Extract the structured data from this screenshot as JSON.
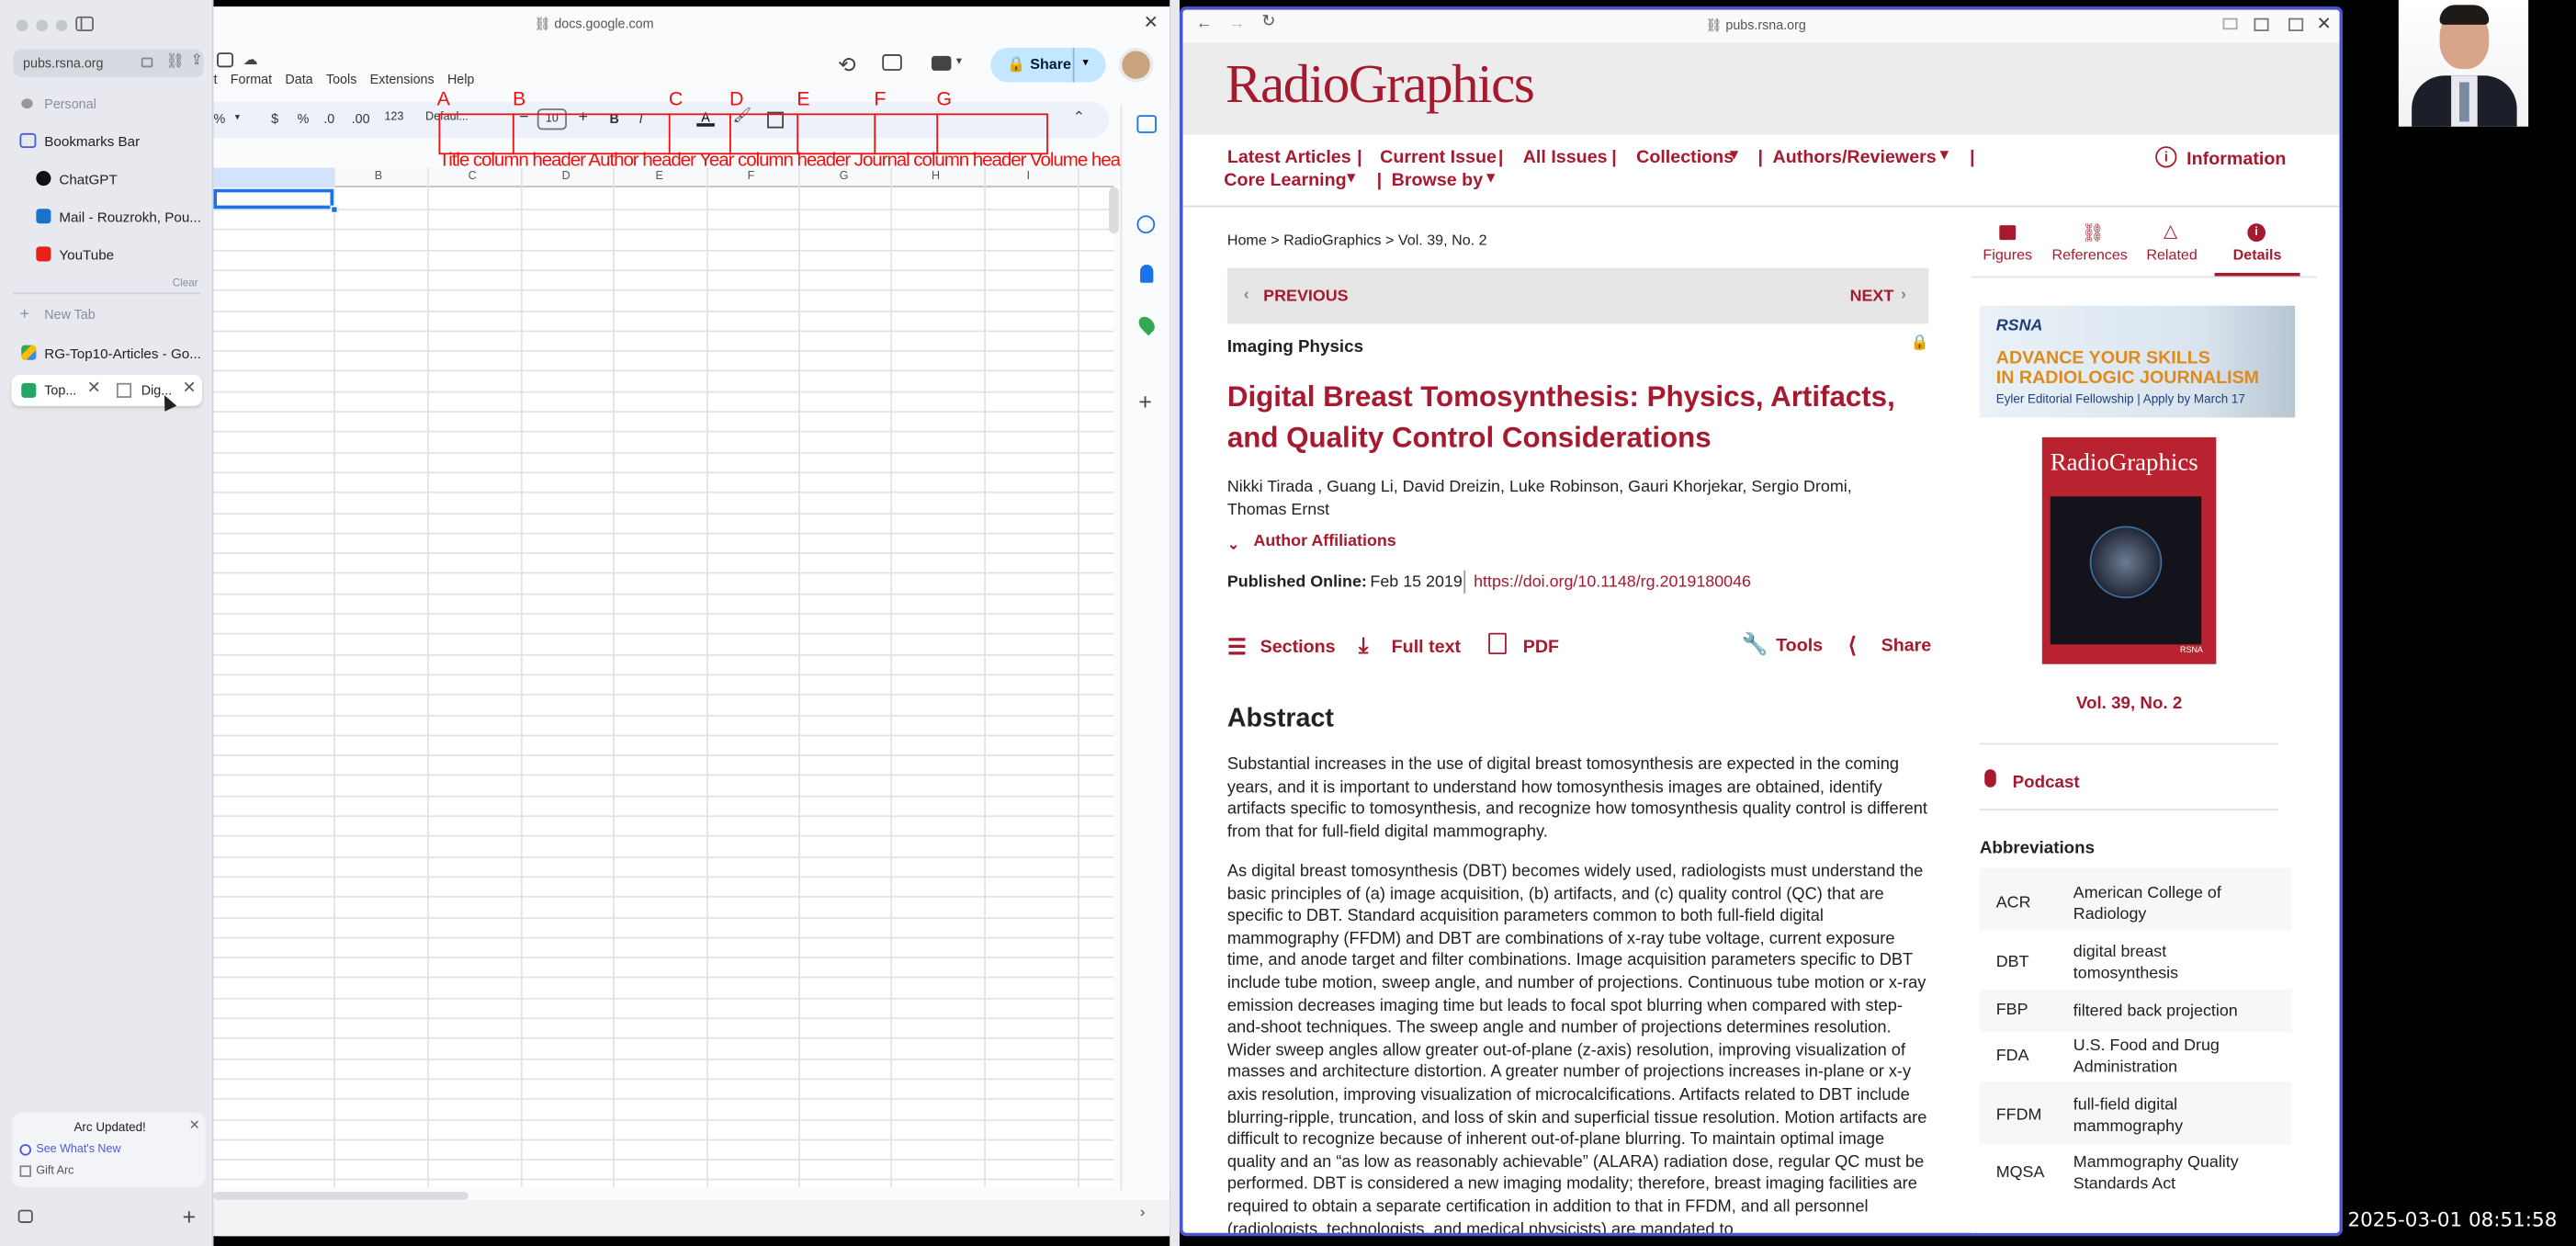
{
  "sidebar": {
    "url": "pubs.rsna.org",
    "personal": "Personal",
    "bookmarks_bar": "Bookmarks Bar",
    "bookmarks": [
      "ChatGPT",
      "Mail - Rouzrokh, Pou...",
      "YouTube"
    ],
    "clear": "Clear",
    "new_tab": "New Tab",
    "tabs": [
      "RG-Top10-Articles - Go..."
    ],
    "split_tabs": [
      "Top...",
      "Dig..."
    ],
    "update_title": "Arc Updated!",
    "update_link1": "See What's New",
    "update_link2": "Gift Arc"
  },
  "sheets": {
    "url": "docs.google.com",
    "menu": [
      "t",
      "Format",
      "Data",
      "Tools",
      "Extensions",
      "Help"
    ],
    "share": "Share",
    "toolbar": {
      "pct": "%",
      "dollar": "$",
      "percent": "%",
      "dec1": ".0",
      "dec2": ".00",
      "num": "123",
      "font": "Defaul...",
      "size": "10",
      "bold": "B",
      "italic": "I"
    },
    "letters": [
      "A",
      "B",
      "C",
      "D",
      "E",
      "F",
      "G"
    ],
    "overlap_text": "Title column header Author header Year column header Journal column header Volume header Issue header Pages header DOI column header",
    "col_headers": [
      "B",
      "C",
      "D",
      "E",
      "F",
      "G",
      "H",
      "I"
    ]
  },
  "rg": {
    "url": "pubs.rsna.org",
    "logo": "RadioGraphics",
    "nav": [
      "Latest Articles",
      "Current Issue",
      "All Issues",
      "Collections",
      "Authors/Reviewers",
      "Core Learning",
      "Browse by"
    ],
    "sep": "|",
    "info": "Information",
    "breadcrumb": "Home > RadioGraphics > Vol. 39, No. 2",
    "prev": "PREVIOUS",
    "next": "NEXT",
    "section": "Imaging Physics",
    "title": "Digital Breast Tomosynthesis: Physics, Artifacts, and Quality Control Considerations",
    "authors_l1": "Nikki Tirada , Guang Li, David Dreizin, Luke Robinson, Gauri Khorjekar, Sergio Dromi,",
    "authors_l2": "Thomas Ernst",
    "affiliations": "Author Affiliations",
    "pub_label": "Published Online:",
    "pub_date": "Feb 15 2019",
    "doi": "https://doi.org/10.1148/rg.2019180046",
    "actions": [
      "Sections",
      "Full text",
      "PDF",
      "Tools",
      "Share"
    ],
    "abstract_h": "Abstract",
    "p1": "Substantial increases in the use of digital breast tomosynthesis are expected in the coming years, and it is important to understand how tomosynthesis images are obtained, identify artifacts specific to tomosynthesis, and recognize how tomosynthesis quality control is different from that for full-field digital mammography.",
    "p2": "As digital breast tomosynthesis (DBT) becomes widely used, radiologists must understand the basic principles of (a) image acquisition, (b) artifacts, and (c) quality control (QC) that are specific to DBT. Standard acquisition parameters common to both full-field digital mammography (FFDM) and DBT are combinations of x-ray tube voltage, current exposure time, and anode target and filter combinations. Image acquisition parameters specific to DBT include tube motion, sweep angle, and number of projections. Continuous tube motion or x-ray emission decreases imaging time but leads to focal spot blurring when compared with step-and-shoot techniques. The sweep angle and number of projections determines resolution. Wider sweep angles allow greater out-of-plane (z-axis) resolution, improving visualization of masses and architecture distortion. A greater number of projections increases in-plane or x-y axis resolution, improving visualization of microcalcifications. Artifacts related to DBT include blurring-ripple, truncation, and loss of skin and superficial tissue resolution. Motion artifacts are difficult to recognize because of inherent out-of-plane blurring. To maintain optimal image quality and an “as low as reasonably achievable” (ALARA) radiation dose, regular QC must be performed. DBT is considered a new imaging modality; therefore, breast imaging facilities are required to obtain a separate certification in addition to that in FFDM, and all personnel (radiologists, technologists, and medical physicists) are mandated to",
    "right_tabs": [
      "Figures",
      "References",
      "Related",
      "Details"
    ],
    "ad": {
      "brand": "RSNA",
      "l1": "ADVANCE YOUR SKILLS",
      "l2": "IN RADIOLOGIC JOURNALISM",
      "l3": "Eyler Editorial Fellowship | Apply by March 17"
    },
    "cover_title": "RadioGraphics",
    "cover_brand": "RSNA",
    "vol": "Vol. 39, No. 2",
    "podcast": "Podcast",
    "abbr_h": "Abbreviations",
    "abbr": [
      {
        "k": "ACR",
        "v": "American College of Radiology"
      },
      {
        "k": "DBT",
        "v": "digital breast tomosynthesis"
      },
      {
        "k": "FBP",
        "v": "filtered back projection"
      },
      {
        "k": "FDA",
        "v": "U.S. Food and Drug Administration"
      },
      {
        "k": "FFDM",
        "v": "full-field digital mammography"
      },
      {
        "k": "MQSA",
        "v": "Mammography Quality Standards Act"
      }
    ]
  },
  "timestamp": "2025-03-01  08:51:58",
  "colors": {
    "rg_red": "#a6192e",
    "annotation_red": "#ee1111",
    "share_blue": "#c2e7ff",
    "window_border": "#4a57d0"
  }
}
